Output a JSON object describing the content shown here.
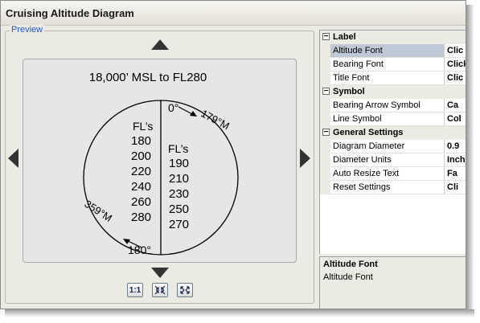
{
  "window": {
    "title": "Cruising Altitude Diagram"
  },
  "preview": {
    "label": "Preview",
    "diagram": {
      "title": "18,000’ MSL to FL280",
      "top_bearing": "0°",
      "right_arrow_label": "179°M",
      "bottom_bearing": "180°",
      "left_arrow_label": "359°M",
      "left_header": "FL’s",
      "left_levels": [
        "180",
        "200",
        "220",
        "240",
        "260",
        "280"
      ],
      "right_header": "FL’s",
      "right_levels": [
        "190",
        "210",
        "230",
        "250",
        "270"
      ]
    },
    "nav_icons": [
      "arrow-up-icon",
      "arrow-down-icon",
      "arrow-left-icon",
      "arrow-right-icon"
    ],
    "toolbar": {
      "actual_size_label": "1:1",
      "zoom_in_icon": "shrink-arrows-icon",
      "zoom_out_icon": "expand-arrows-icon"
    }
  },
  "property_grid": {
    "categories": [
      {
        "label": "Label",
        "toggle": "−",
        "properties": [
          {
            "name": "Altitude Font",
            "value": "Clic",
            "selected": true
          },
          {
            "name": "Bearing Font",
            "value": "Click"
          },
          {
            "name": "Title Font",
            "value": "Clic"
          }
        ]
      },
      {
        "label": "Symbol",
        "toggle": "−",
        "properties": [
          {
            "name": "Bearing Arrow Symbol",
            "value": "Ca"
          },
          {
            "name": "Line Symbol",
            "value": "Col"
          }
        ]
      },
      {
        "label": "General Settings",
        "toggle": "−",
        "properties": [
          {
            "name": "Diagram Diameter",
            "value": "0.9"
          },
          {
            "name": "Diameter Units",
            "value": "Inch"
          },
          {
            "name": "Auto Resize Text",
            "value": "Fa"
          },
          {
            "name": "Reset Settings",
            "value": "Cli"
          }
        ]
      }
    ]
  },
  "description": {
    "title": "Altitude Font",
    "text": "Altitude Font"
  }
}
